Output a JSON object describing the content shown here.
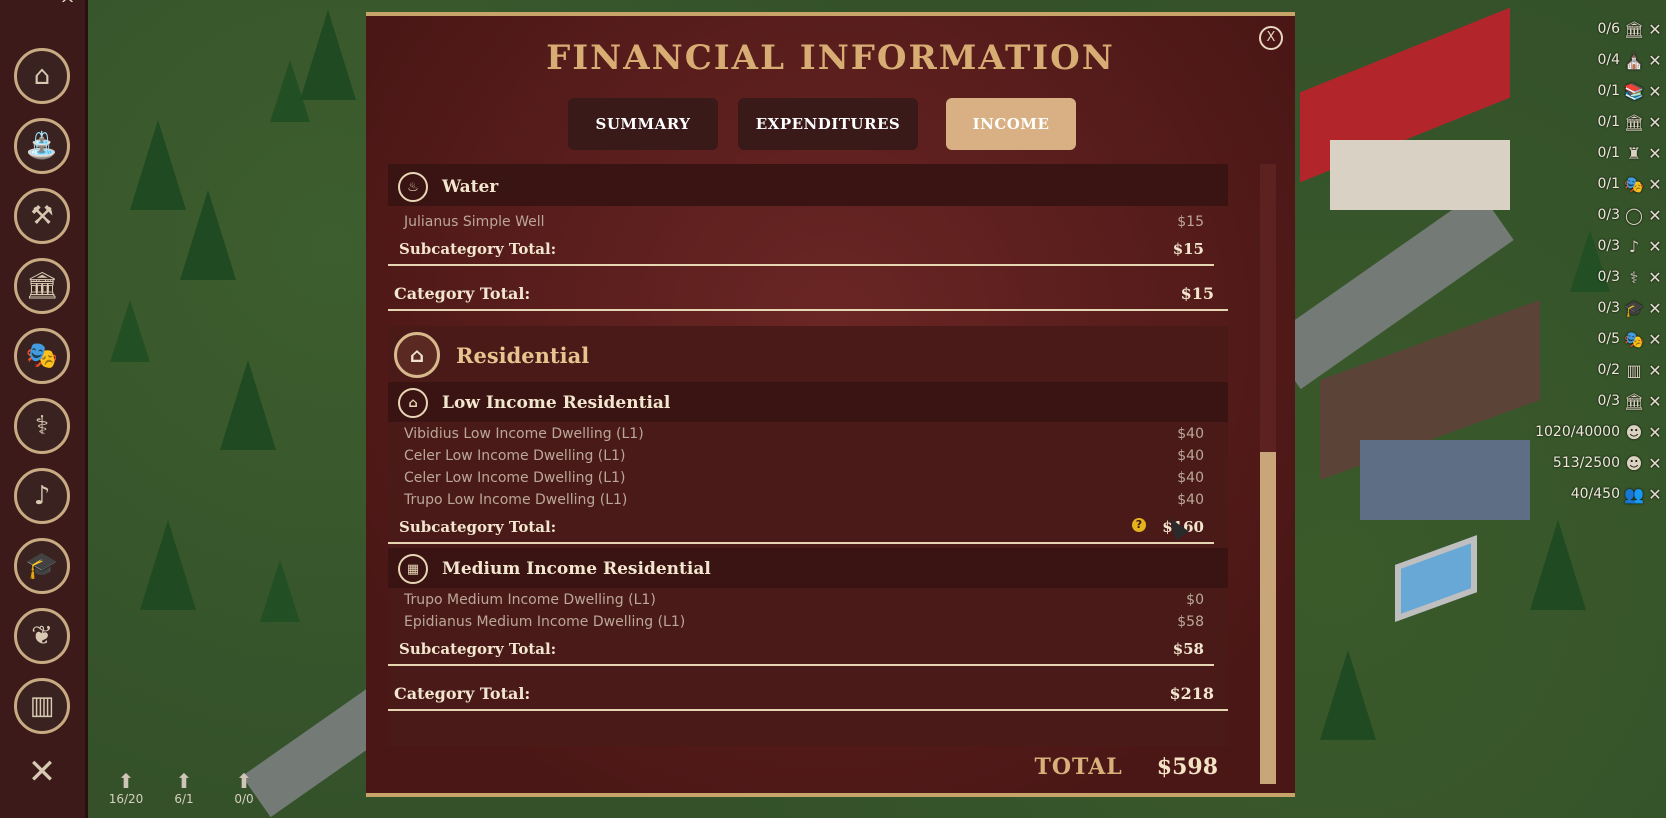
{
  "modal": {
    "title": "FINANCIAL INFORMATION",
    "close_label": "X",
    "tabs": [
      {
        "label": "SUMMARY",
        "active": false
      },
      {
        "label": "EXPENDITURES",
        "active": false
      },
      {
        "label": "INCOME",
        "active": true
      }
    ]
  },
  "income": {
    "water": {
      "subcategory": "Water",
      "rows": [
        {
          "name": "Julianus Simple Well",
          "amount": "$15"
        }
      ],
      "subtotal_label": "Subcategory Total:",
      "subtotal_amount": "$15",
      "category_total_label": "Category Total:",
      "category_total_amount": "$15"
    },
    "residential": {
      "category": "Residential",
      "low": {
        "title": "Low Income Residential",
        "rows": [
          {
            "name": "Vibidius Low Income Dwelling (L1)",
            "amount": "$40"
          },
          {
            "name": "Celer Low Income Dwelling (L1)",
            "amount": "$40"
          },
          {
            "name": "Celer Low Income Dwelling (L1)",
            "amount": "$40"
          },
          {
            "name": "Trupo Low Income Dwelling (L1)",
            "amount": "$40"
          }
        ],
        "subtotal_label": "Subcategory Total:",
        "subtotal_amount": "$160"
      },
      "medium": {
        "title": "Medium Income Residential",
        "rows": [
          {
            "name": "Trupo Medium Income Dwelling (L1)",
            "amount": "$0"
          },
          {
            "name": "Epidianus Medium Income Dwelling (L1)",
            "amount": "$58"
          }
        ],
        "subtotal_label": "Subcategory Total:",
        "subtotal_amount": "$58"
      },
      "category_total_label": "Category Total:",
      "category_total_amount": "$218"
    },
    "total_label": "TOTAL",
    "total_amount": "$598",
    "help_glyph": "?"
  },
  "left_toolbar": {
    "collapse_glyph": "^",
    "buttons": [
      {
        "name": "housing",
        "glyph": "⌂"
      },
      {
        "name": "water",
        "glyph": "⛲"
      },
      {
        "name": "industry",
        "glyph": "⚒"
      },
      {
        "name": "government",
        "glyph": "🏛"
      },
      {
        "name": "entertainment",
        "glyph": "🎭"
      },
      {
        "name": "health",
        "glyph": "⚕"
      },
      {
        "name": "music",
        "glyph": "♪"
      },
      {
        "name": "education",
        "glyph": "🎓"
      },
      {
        "name": "religion",
        "glyph": "❦"
      },
      {
        "name": "military",
        "glyph": "▥"
      },
      {
        "name": "close",
        "glyph": "✕"
      }
    ]
  },
  "bottom_stats": [
    {
      "value": "16/20",
      "icon": "person-up-icon"
    },
    {
      "value": "6/1",
      "icon": "person-up-icon"
    },
    {
      "value": "0/0",
      "icon": "person-up-icon"
    }
  ],
  "right_stats": [
    {
      "value": "0/6",
      "icon": "temple-icon",
      "glyph": "🏛"
    },
    {
      "value": "0/4",
      "icon": "forum-icon",
      "glyph": "⛪"
    },
    {
      "value": "0/1",
      "icon": "library-icon",
      "glyph": "📚"
    },
    {
      "value": "0/1",
      "icon": "basilica-icon",
      "glyph": "🏛"
    },
    {
      "value": "0/1",
      "icon": "statue-icon",
      "glyph": "♜"
    },
    {
      "value": "0/1",
      "icon": "theater-icon",
      "glyph": "🎭"
    },
    {
      "value": "0/3",
      "icon": "laurel-icon",
      "glyph": "◯"
    },
    {
      "value": "0/3",
      "icon": "music-icon",
      "glyph": "♪"
    },
    {
      "value": "0/3",
      "icon": "health-icon",
      "glyph": "⚕"
    },
    {
      "value": "0/3",
      "icon": "education-icon",
      "glyph": "🎓"
    },
    {
      "value": "0/5",
      "icon": "mask-icon",
      "glyph": "🎭"
    },
    {
      "value": "0/2",
      "icon": "standard-icon",
      "glyph": "▥"
    },
    {
      "value": "0/3",
      "icon": "bank-icon",
      "glyph": "🏛"
    },
    {
      "value": "1020/40000",
      "icon": "bust-icon",
      "glyph": "☻"
    },
    {
      "value": "513/2500",
      "icon": "bust-icon",
      "glyph": "☻"
    },
    {
      "value": "40/450",
      "icon": "population-icon",
      "glyph": "👥"
    }
  ],
  "colors": {
    "modal_bg": "#5a1f1e",
    "title_gold": "#d8ad74",
    "tab_active": "#d9b083",
    "toolbar_bg": "#3b1a19"
  }
}
